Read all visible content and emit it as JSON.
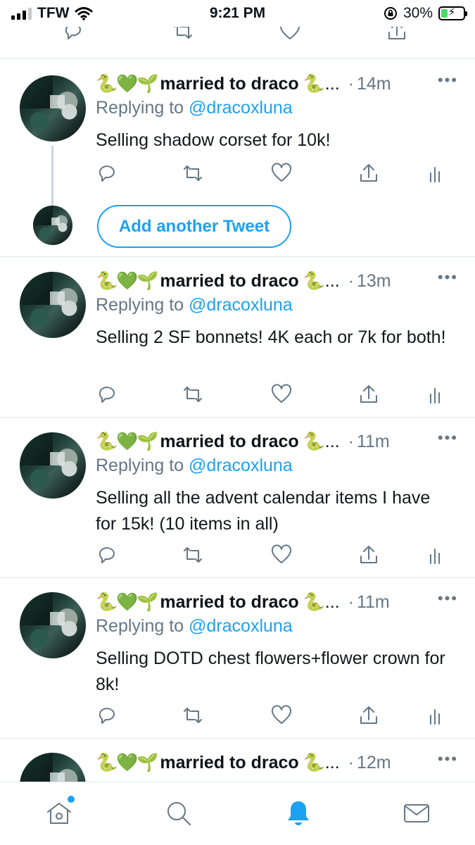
{
  "status_bar": {
    "carrier": "TFW",
    "time": "9:21 PM",
    "battery_percent": "30%",
    "battery_level": 0.3
  },
  "tweets": [
    {
      "emojis": "🐍💚🌱",
      "name": "married to draco",
      "name_trail": "🐍...",
      "dot": "·",
      "time": "14m",
      "more": "•••",
      "reply_prefix": "Replying to",
      "reply_handle": "@dracoxluna",
      "text": "Selling shadow corset for 10k!"
    },
    {
      "emojis": "🐍💚🌱",
      "name": "married to draco",
      "name_trail": "🐍...",
      "dot": "·",
      "time": "13m",
      "more": "•••",
      "reply_prefix": "Replying to",
      "reply_handle": "@dracoxluna",
      "text": "Selling 2 SF bonnets! 4K each or 7k for both!"
    },
    {
      "emojis": "🐍💚🌱",
      "name": "married to draco",
      "name_trail": "🐍...",
      "dot": "·",
      "time": "11m",
      "more": "•••",
      "reply_prefix": "Replying to",
      "reply_handle": "@dracoxluna",
      "text": "Selling all the advent calendar items I have for 15k! (10 items in all)"
    },
    {
      "emojis": "🐍💚🌱",
      "name": "married to draco",
      "name_trail": "🐍...",
      "dot": "·",
      "time": "11m",
      "more": "•••",
      "reply_prefix": "Replying to",
      "reply_handle": "@dracoxluna",
      "text": "Selling DOTD chest flowers+flower crown for 8k!"
    },
    {
      "emojis": "🐍💚🌱",
      "name": "married to draco",
      "name_trail": "🐍...",
      "dot": "·",
      "time": "12m",
      "more": "•••"
    }
  ],
  "add_tweet_label": "Add another Tweet",
  "action_icons": [
    "reply-icon",
    "retweet-icon",
    "like-icon",
    "share-icon",
    "analytics-icon"
  ],
  "tab_bar": {
    "tabs": [
      "home-icon",
      "search-icon",
      "notifications-icon",
      "messages-icon"
    ],
    "active": "notifications-icon"
  },
  "colors": {
    "accent": "#1da1f2",
    "secondary_text": "#657786",
    "divider": "#e1e8ed",
    "battery_fill": "#4cd964"
  }
}
